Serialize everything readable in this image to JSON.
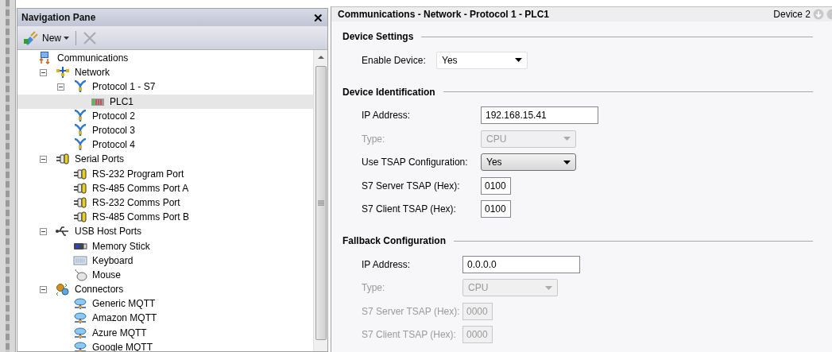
{
  "navigation_pane": {
    "title": "Navigation Pane",
    "close": "✕",
    "toolbar": {
      "new_label": "New"
    },
    "tree": [
      {
        "label": "Communications",
        "kind": "comms",
        "selected": false,
        "children": [
          {
            "label": "Network",
            "kind": "network",
            "selected": false,
            "expanded": true,
            "children": [
              {
                "label": "Protocol 1 - S7",
                "kind": "protocol",
                "selected": false,
                "expanded": true,
                "children": [
                  {
                    "label": "PLC1",
                    "kind": "plc",
                    "selected": true
                  }
                ]
              },
              {
                "label": "Protocol 2",
                "kind": "protocol",
                "selected": false
              },
              {
                "label": "Protocol 3",
                "kind": "protocol",
                "selected": false
              },
              {
                "label": "Protocol 4",
                "kind": "protocol",
                "selected": false
              }
            ]
          },
          {
            "label": "Serial Ports",
            "kind": "serial",
            "selected": false,
            "expanded": true,
            "children": [
              {
                "label": "RS-232 Program Port",
                "kind": "serial",
                "selected": false
              },
              {
                "label": "RS-485 Comms Port A",
                "kind": "serial",
                "selected": false
              },
              {
                "label": "RS-232 Comms Port",
                "kind": "serial",
                "selected": false
              },
              {
                "label": "RS-485 Comms Port B",
                "kind": "serial",
                "selected": false
              }
            ]
          },
          {
            "label": "USB Host Ports",
            "kind": "usb",
            "selected": false,
            "expanded": true,
            "children": [
              {
                "label": "Memory Stick",
                "kind": "memory",
                "selected": false
              },
              {
                "label": "Keyboard",
                "kind": "keyboard",
                "selected": false
              },
              {
                "label": "Mouse",
                "kind": "mouse",
                "selected": false
              }
            ]
          },
          {
            "label": "Connectors",
            "kind": "connectors",
            "selected": false,
            "expanded": true,
            "children": [
              {
                "label": "Generic MQTT",
                "kind": "cloud",
                "selected": false
              },
              {
                "label": "Amazon MQTT",
                "kind": "cloud",
                "selected": false
              },
              {
                "label": "Azure MQTT",
                "kind": "cloud",
                "selected": false
              },
              {
                "label": "Google MQTT",
                "kind": "cloud",
                "selected": false
              }
            ]
          }
        ]
      }
    ]
  },
  "editor": {
    "title": "Communications - Network - Protocol 1 - PLC1",
    "device": "Device 2",
    "sections": [
      {
        "title": "Device Settings",
        "fields": [
          {
            "label": "Enable Device:",
            "kind": "select",
            "value": "Yes",
            "disabled": false
          }
        ]
      },
      {
        "title": "Device Identification",
        "fields": [
          {
            "label": "IP Address:",
            "kind": "text",
            "value": "192.168.15.41",
            "disabled": false
          },
          {
            "label": "Type:",
            "kind": "select",
            "value": "CPU",
            "disabled": true
          },
          {
            "label": "Use TSAP Configuration:",
            "kind": "button-select",
            "value": "Yes",
            "disabled": false
          },
          {
            "label": "S7 Server TSAP (Hex):",
            "kind": "hex",
            "value": "0100",
            "disabled": false
          },
          {
            "label": "S7 Client TSAP (Hex):",
            "kind": "hex",
            "value": "0100",
            "disabled": false
          }
        ]
      },
      {
        "title": "Fallback Configuration",
        "fields": [
          {
            "label": "IP Address:",
            "kind": "text",
            "value": "0.0.0.0",
            "disabled": false
          },
          {
            "label": "Type:",
            "kind": "select",
            "value": "CPU",
            "disabled": true
          },
          {
            "label": "S7 Server TSAP (Hex):",
            "kind": "hex",
            "value": "0000",
            "disabled": true
          },
          {
            "label": "S7 Client TSAP (Hex):",
            "kind": "hex",
            "value": "0000",
            "disabled": true
          }
        ]
      }
    ]
  }
}
